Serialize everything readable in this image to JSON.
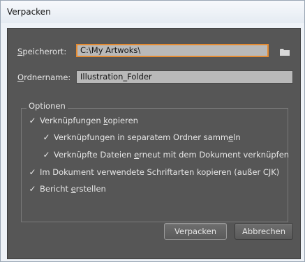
{
  "window": {
    "title": "Verpacken"
  },
  "location": {
    "label_pre": "",
    "label_u": "S",
    "label_post": "peicherort:",
    "value": "C:\\My Artwoks\\"
  },
  "folder": {
    "label_pre": "",
    "label_u": "O",
    "label_post": "rdnername:",
    "value": "Illustration_Folder"
  },
  "options": {
    "legend": "Optionen",
    "items": [
      {
        "checked": "✓",
        "pre": "Verknüpfungen ",
        "u": "k",
        "post": "opieren"
      },
      {
        "checked": "✓",
        "pre": "Verknüpfungen in separatem Ordner samm",
        "u": "e",
        "post": "ln"
      },
      {
        "checked": "✓",
        "pre": "Verknüpfte Dateien ",
        "u": "e",
        "post": "rneut mit dem Dokument verknüpfen"
      },
      {
        "checked": "✓",
        "pre": "Im Dokument verwendete Schriftarten kopieren (außer CJK)",
        "u": "",
        "post": ""
      },
      {
        "checked": "✓",
        "pre": "Bericht ",
        "u": "e",
        "post": "rstellen"
      }
    ]
  },
  "buttons": {
    "package": "Verpacken",
    "cancel": "Abbrechen"
  },
  "icons": {
    "browse": "folder-icon",
    "check": "check-icon"
  },
  "colors": {
    "focus_border": "#e48b32",
    "panel_bg": "#565656",
    "field_bg": "#b9b9b9"
  }
}
